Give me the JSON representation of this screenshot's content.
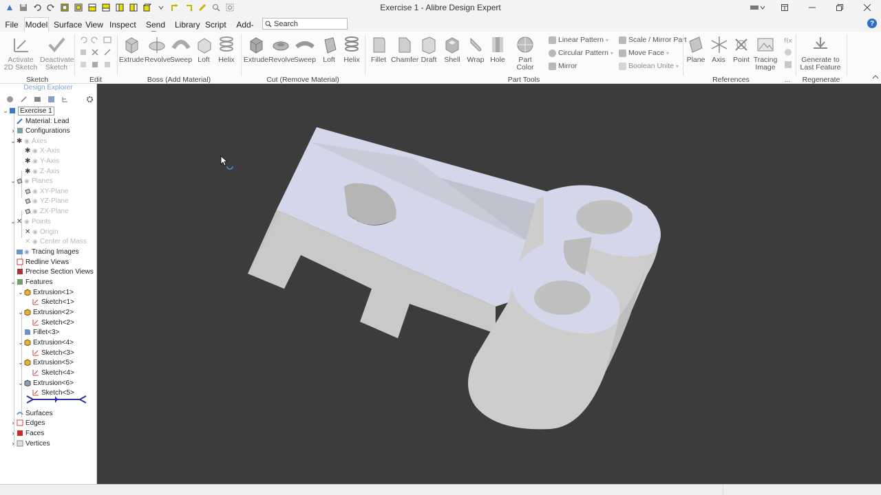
{
  "window": {
    "title": "Exercise 1 - Alibre Design Expert"
  },
  "menu": {
    "items": [
      "File",
      "Model",
      "Surface",
      "View",
      "Inspect",
      "Send To",
      "Library",
      "Script",
      "Add-on"
    ],
    "active": "Model",
    "search_label": "Search",
    "help_glyph": "?"
  },
  "ribbon": {
    "sketch": {
      "activate_line1": "Activate",
      "activate_line2": "2D Sketch",
      "deactivate_line1": "Deactivate",
      "deactivate_line2": "Sketch",
      "group_label": "Sketch"
    },
    "edit": {
      "group_label": "Edit"
    },
    "boss": {
      "extrude": "Extrude",
      "revolve": "Revolve",
      "sweep": "Sweep",
      "loft": "Loft",
      "helix": "Helix",
      "group_label": "Boss (Add Material)"
    },
    "cut": {
      "extrude": "Extrude",
      "revolve": "Revolve",
      "sweep": "Sweep",
      "loft": "Loft",
      "helix": "Helix",
      "group_label": "Cut (Remove Material)"
    },
    "part_tools": {
      "fillet": "Fillet",
      "chamfer": "Chamfer",
      "draft": "Draft",
      "shell": "Shell",
      "wrap": "Wrap",
      "hole": "Hole",
      "part_color_line1": "Part Color",
      "linear_pattern": "Linear Pattern",
      "circular_pattern": "Circular Pattern",
      "mirror": "Mirror",
      "scale_mirror": "Scale / Mirror Part",
      "move_face": "Move Face",
      "boolean_unite": "Boolean Unite",
      "group_label": "Part Tools"
    },
    "references": {
      "plane": "Plane",
      "axis": "Axis",
      "point": "Point",
      "tracing_line1": "Tracing",
      "tracing_line2": "Image",
      "group_label": "References",
      "overflow": "..."
    },
    "regenerate": {
      "line1": "Generate to",
      "line2": "Last Feature",
      "group_label": "Regenerate"
    }
  },
  "explorer": {
    "title": "Design Explorer",
    "tree": {
      "root": "Exercise 1",
      "material": "Material: Lead",
      "configurations": "Configurations",
      "axes": "Axes",
      "x_axis": "X-Axis",
      "y_axis": "Y-Axis",
      "z_axis": "Z-Axis",
      "planes": "Planes",
      "xy_plane": "XY-Plane",
      "yz_plane": "YZ-Plane",
      "zx_plane": "ZX-Plane",
      "points": "Points",
      "origin": "Origin",
      "center_of_mass": "Center of Mass",
      "tracing_images": "Tracing Images",
      "redline_views": "Redline Views",
      "precise_section_views": "Precise Section Views",
      "features": "Features",
      "extrusion1": "Extrusion<1>",
      "sketch1": "Sketch<1>",
      "extrusion2": "Extrusion<2>",
      "sketch2": "Sketch<2>",
      "fillet3": "Fillet<3>",
      "extrusion4": "Extrusion<4>",
      "sketch3": "Sketch<3>",
      "extrusion5": "Extrusion<5>",
      "sketch4": "Sketch<4>",
      "extrusion6": "Extrusion<6>",
      "sketch5": "Sketch<5>",
      "surfaces": "Surfaces",
      "edges": "Edges",
      "faces": "Faces",
      "vertices": "Vertices"
    }
  },
  "colors": {
    "accent": "#2b6fc9",
    "viewport_bg": "#3c3c3c",
    "part_top": "#d4d6ea",
    "part_side": "#cdcdcd",
    "rollback_bar": "#2c2c9a",
    "faces_icon": "#cc2a2a"
  },
  "icons": [
    "save-icon",
    "undo-icon",
    "redo-icon",
    "search-icon",
    "help-icon",
    "minimize-icon",
    "maximize-icon",
    "close-icon",
    "gear-icon",
    "chevron-down-icon",
    "chevron-right-icon",
    "eye-icon"
  ]
}
